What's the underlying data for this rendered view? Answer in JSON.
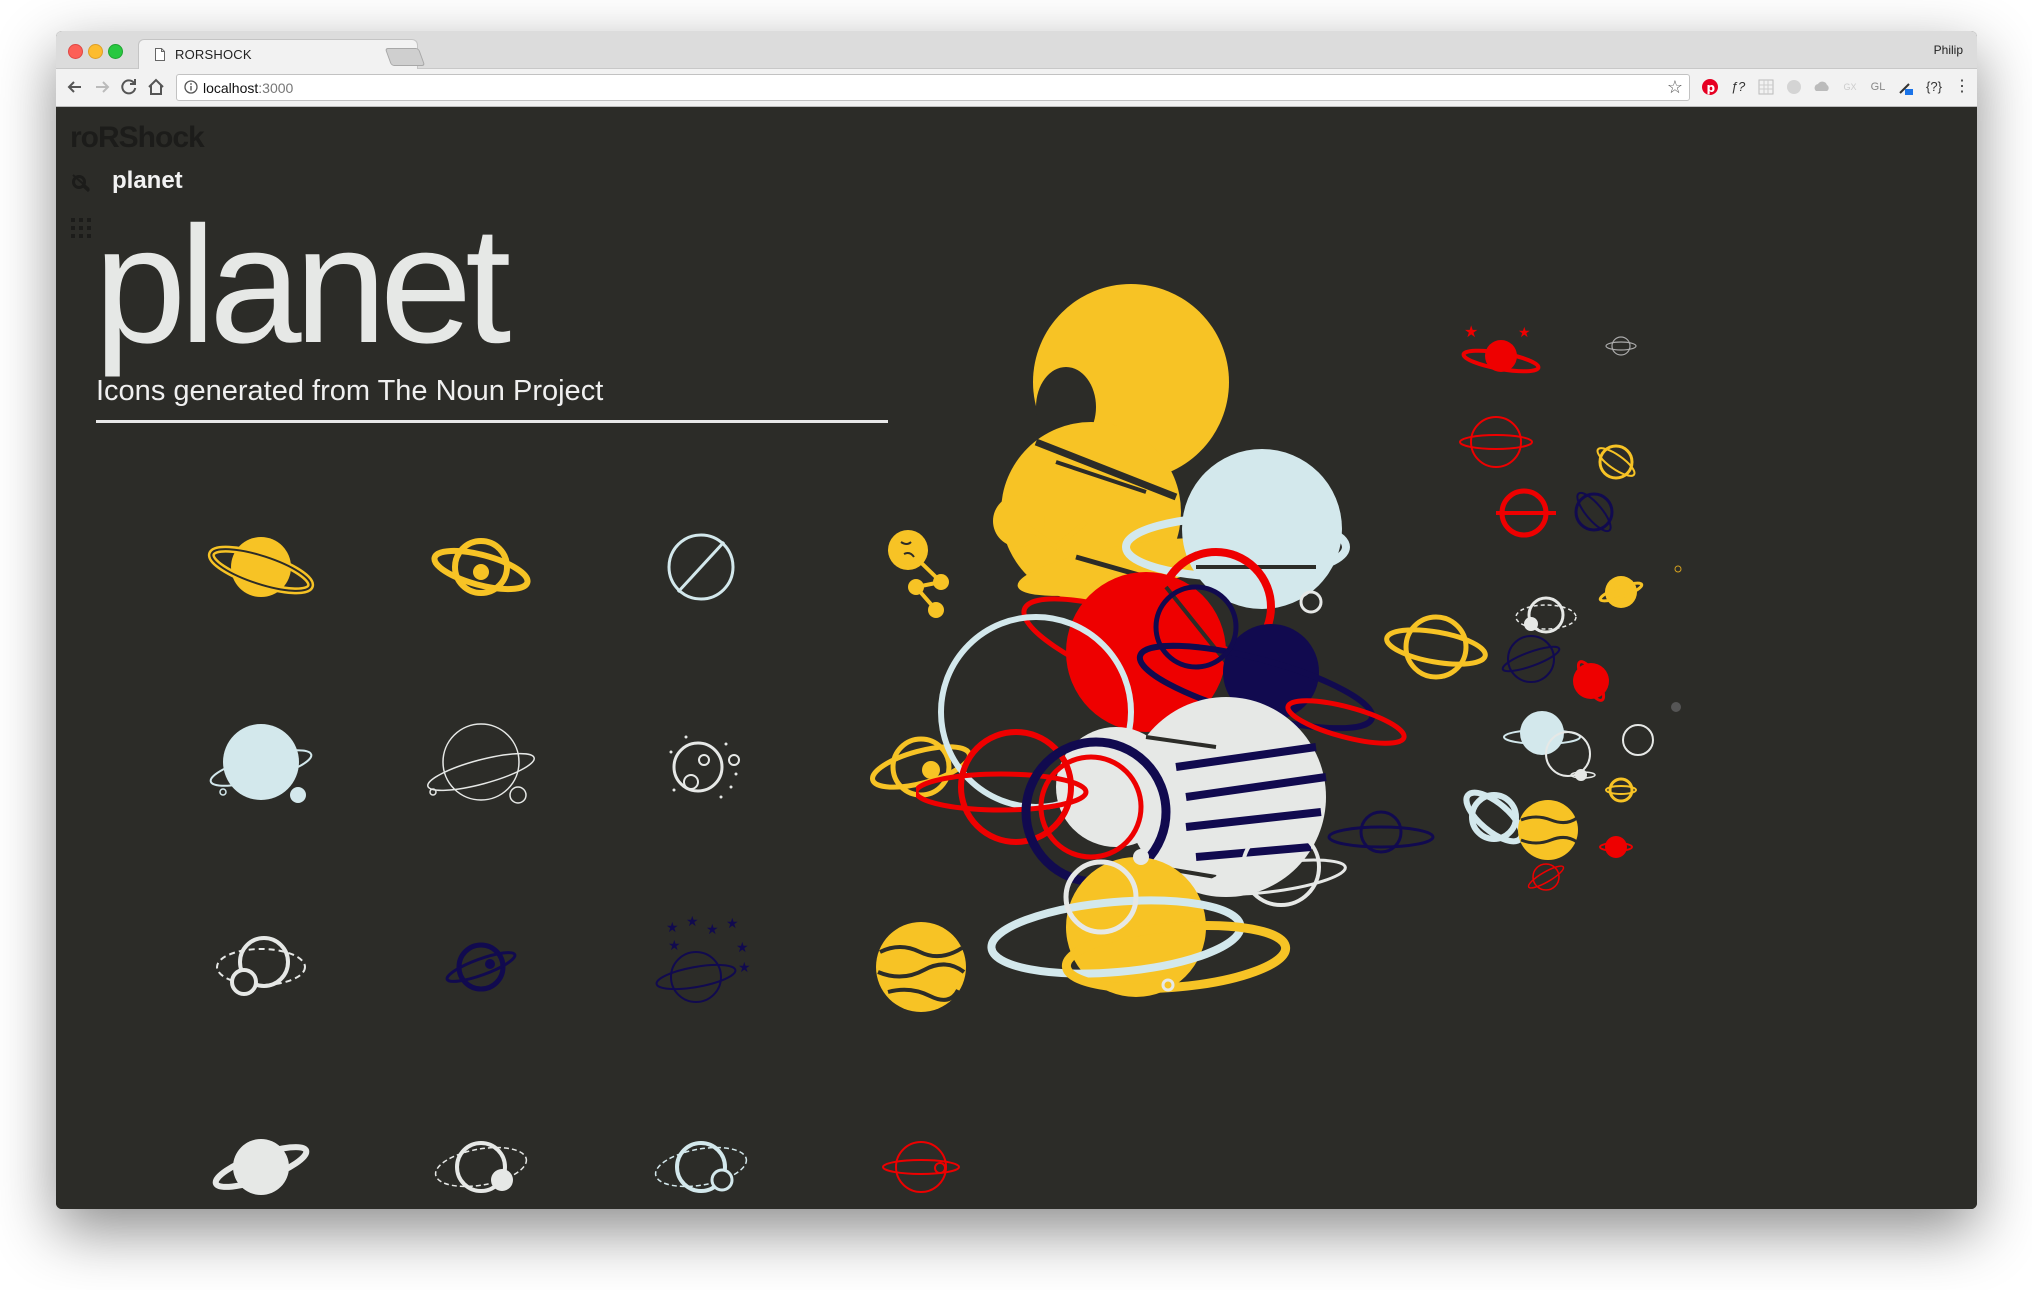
{
  "browser": {
    "tab_title": "RORSHOCK",
    "tab_close": "×",
    "profile_name": "Philip",
    "url_host": "localhost",
    "url_port": ":3000",
    "ext_labels": [
      "ƒ?",
      "GL",
      "{?}",
      "⋮"
    ]
  },
  "app": {
    "logo": "roRShock",
    "search_term": "planet",
    "title": "planet",
    "subtitle": "Icons generated from The Noun Project"
  },
  "colors": {
    "background": "#2c2c28",
    "yellow": "#f7c325",
    "pale_blue": "#d3e8ec",
    "navy": "#110a4f",
    "red": "#ee0000",
    "white": "#e6e8e6"
  },
  "icons": [
    {
      "name": "planet-ringed-solid-icon",
      "color": "yellow"
    },
    {
      "name": "planet-orbit-outline-icon",
      "color": "yellow"
    },
    {
      "name": "planet-slash-outline-icon",
      "color": "pale_blue"
    },
    {
      "name": "planet-molecule-icon",
      "color": "yellow"
    },
    {
      "name": "planet-moon-solid-icon",
      "color": "pale_blue"
    },
    {
      "name": "planet-ring-thin-icon",
      "color": "white"
    },
    {
      "name": "planet-crater-dots-icon",
      "color": "white"
    },
    {
      "name": "planet-ring-dot-icon",
      "color": "yellow"
    },
    {
      "name": "planet-dashed-orbit-icon",
      "color": "white"
    },
    {
      "name": "planet-small-orbit-icon",
      "color": "navy"
    },
    {
      "name": "planet-stars-icon",
      "color": "navy"
    },
    {
      "name": "planet-banded-icon",
      "color": "yellow"
    },
    {
      "name": "planet-ringed-grey-icon",
      "color": "white"
    },
    {
      "name": "planet-dashed-moon-icon",
      "color": "white"
    },
    {
      "name": "planet-dashed-moon-blue-icon",
      "color": "pale_blue"
    },
    {
      "name": "planet-red-outline-icon",
      "color": "red"
    }
  ]
}
